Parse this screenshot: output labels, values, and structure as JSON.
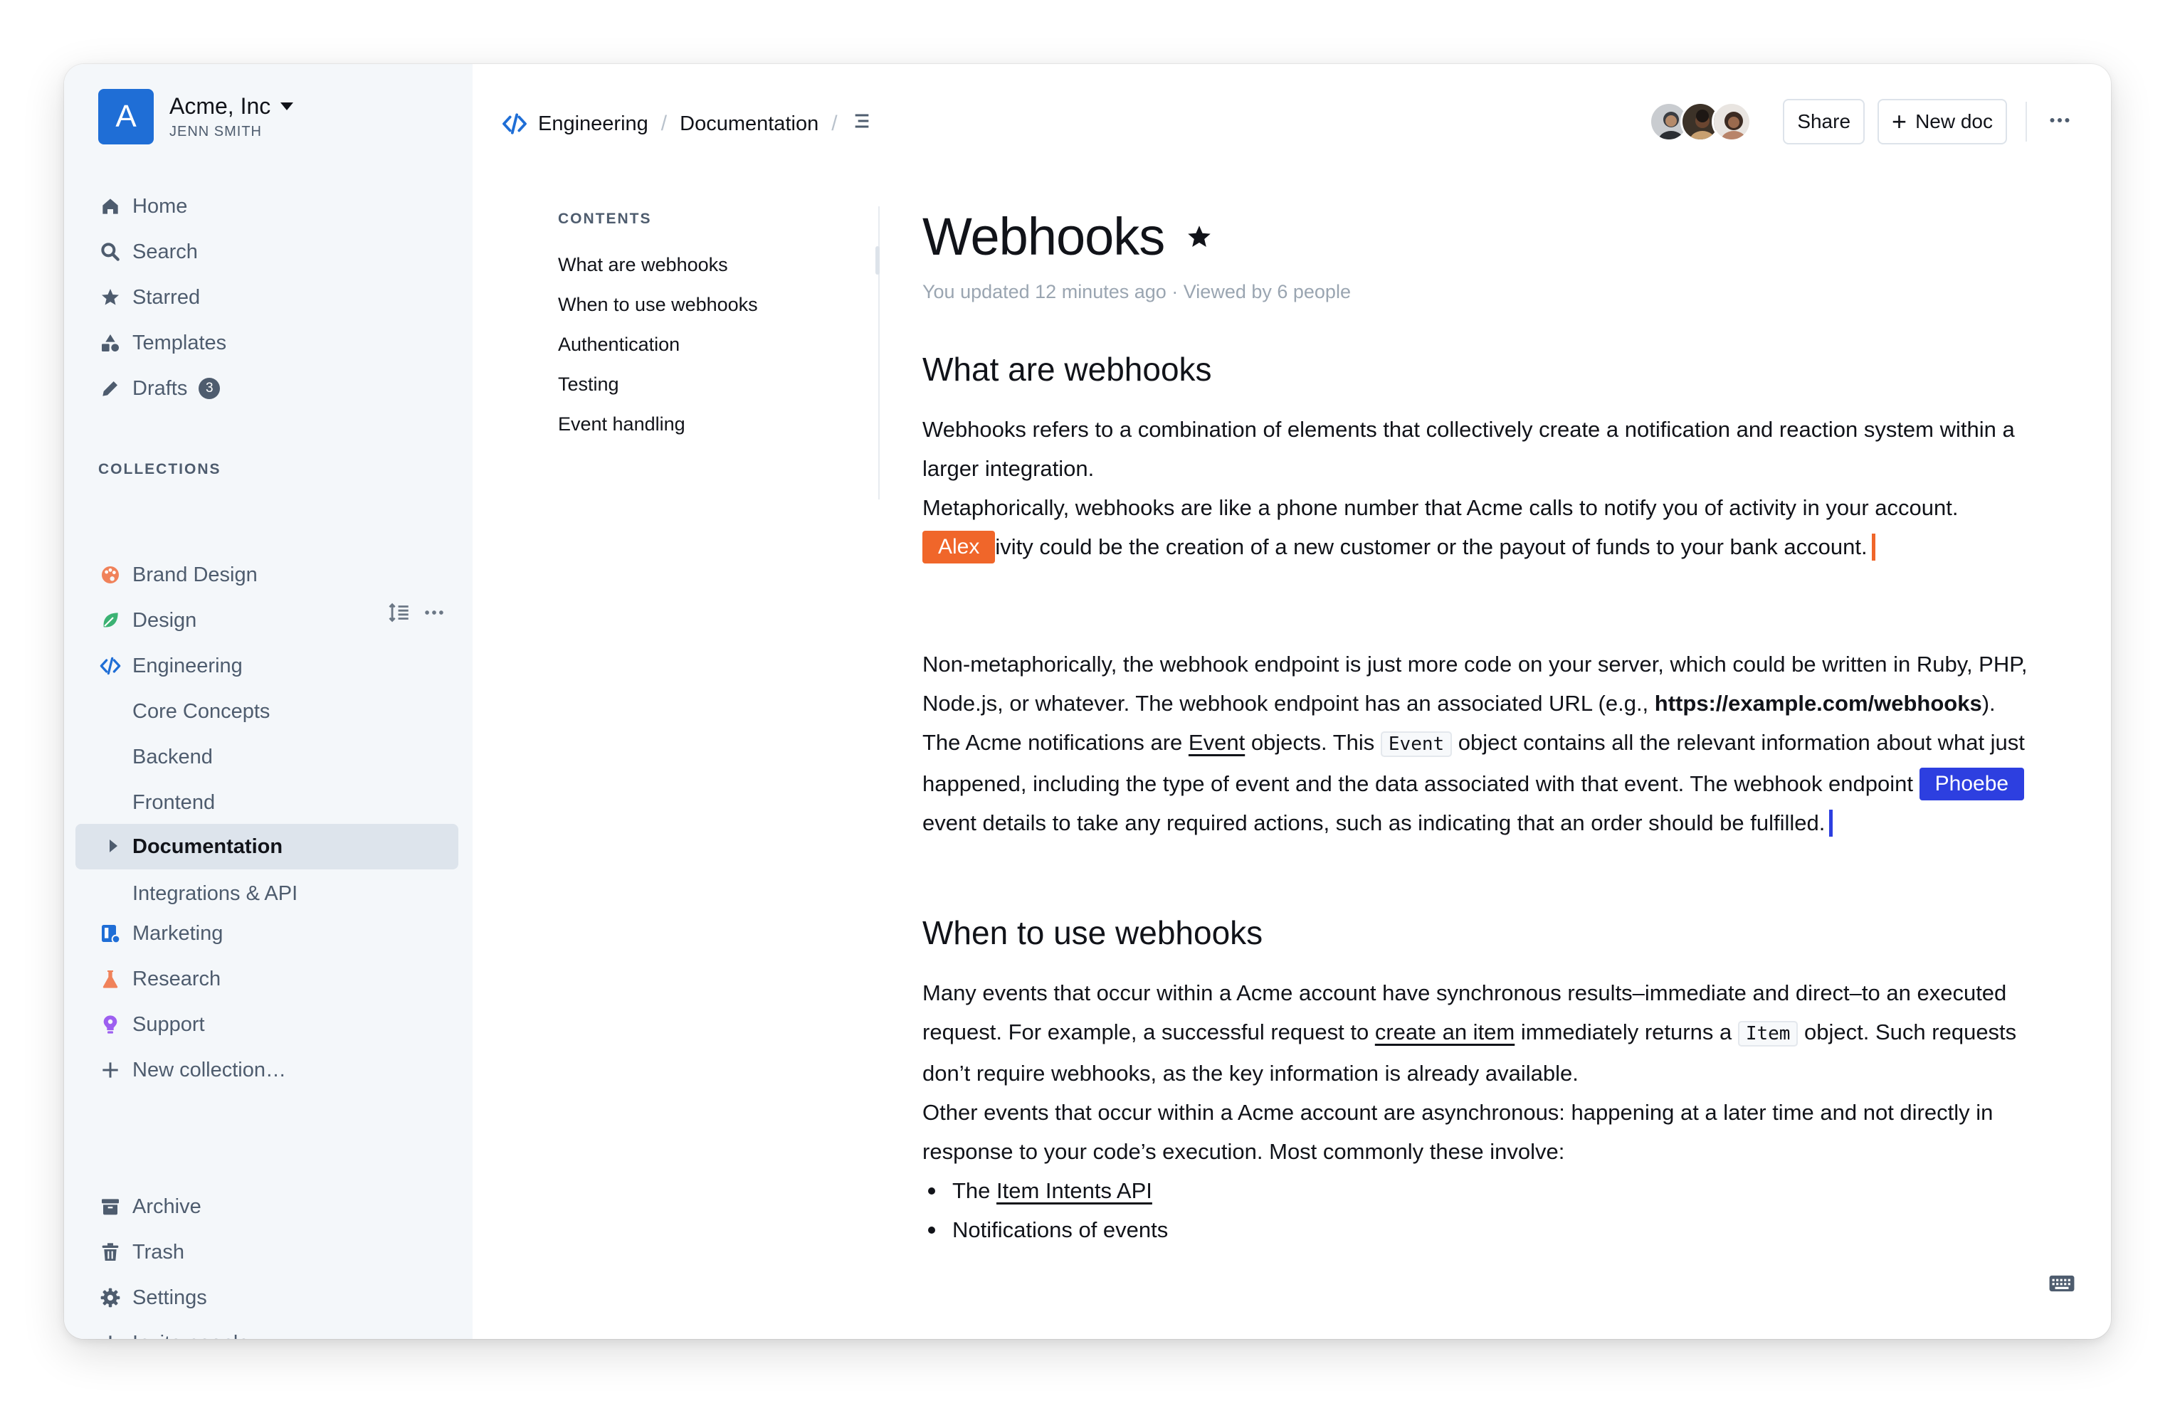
{
  "team": {
    "logo_letter": "A",
    "name": "Acme, Inc",
    "user": "JENN SMITH"
  },
  "nav": {
    "home": "Home",
    "search": "Search",
    "starred": "Starred",
    "templates": "Templates",
    "drafts": "Drafts",
    "drafts_count": "3"
  },
  "collections": {
    "label": "COLLECTIONS",
    "brand_design": "Brand Design",
    "design": "Design",
    "engineering": "Engineering",
    "engineering_children": [
      "Core Concepts",
      "Backend",
      "Frontend",
      "Documentation",
      "Integrations & API"
    ],
    "marketing": "Marketing",
    "research": "Research",
    "support": "Support",
    "new_collection": "New collection…"
  },
  "footer_nav": {
    "archive": "Archive",
    "trash": "Trash",
    "settings": "Settings",
    "invite": "Invite people…"
  },
  "breadcrumb": {
    "collection": "Engineering",
    "document": "Documentation"
  },
  "header": {
    "share": "Share",
    "new_doc": "New doc"
  },
  "toc": {
    "label": "CONTENTS",
    "items": [
      "What are webhooks",
      "When to use webhooks",
      "Authentication",
      "Testing",
      "Event handling"
    ]
  },
  "doc": {
    "title": "Webhooks",
    "meta": "You updated 12 minutes ago · Viewed by 6 people",
    "s1_heading": "What are webhooks",
    "s1_p1": "Webhooks refers to a combination of elements that collectively create a notification and reaction system within a larger integration.",
    "s1_p2_a": "Metaphorically, webhooks are like a phone number that Acme calls to notify you of activity in your account.",
    "s1_p2_b": "ivity could be the creation of a new customer or the payout of funds to your bank account.",
    "s1_p3_a": "Non-metaphorically, the webhook endpoint is just more code on your server, which could be written in Ruby, PHP, Node.js, or whatever. The webhook endpoint has an associated URL (e.g., ",
    "s1_p3_url": "https://example.com/webhooks",
    "s1_p3_b": "). The Acme notifications are ",
    "s1_p3_link": "Event",
    "s1_p3_c": " objects. This ",
    "s1_p3_code": "Event",
    "s1_p3_d": " object contains all the relevant information about what just happened, including the type of event and the data associated with that event. The webhook endpoint",
    "s1_p3_e": "event details to take any required actions, such as indicating that an order should be fulfilled.",
    "s2_heading": "When to use webhooks",
    "s2_p1_a": "Many events that occur within a Acme account have synchronous results–immediate and direct–to an executed request. For example, a successful request to ",
    "s2_p1_link": "create an item",
    "s2_p1_b": " immediately returns a ",
    "s2_p1_code": "Item",
    "s2_p1_c": " object. Such requests don’t require webhooks, as the key information is already available.",
    "s2_p2": "Other events that occur within a Acme account are asynchronous: happening at a later time and not directly in response to your code’s execution. Most commonly these involve:",
    "bullet1_prefix": "The ",
    "bullet1_link": "Item Intents API",
    "bullet2": "Notifications of events"
  },
  "collaborators": [
    {
      "name": "Alex",
      "color": "#f0662a"
    },
    {
      "name": "Phoebe",
      "color": "#2d3fe0"
    }
  ],
  "colors": {
    "accent": "#1f6ed6",
    "sidebar_bg": "#f4f7fa",
    "active_bg": "#dde4ec",
    "text": "#111319",
    "muted": "#4e5c6e"
  },
  "icons": [
    "home-icon",
    "search-icon",
    "star-icon",
    "templates-icon",
    "pencil-icon",
    "palette-icon",
    "leaf-icon",
    "code-icon",
    "marketing-icon",
    "flask-icon",
    "lightbulb-icon",
    "plus-icon",
    "archive-icon",
    "trash-icon",
    "gear-icon",
    "menu-icon",
    "more-icon",
    "keyboard-icon"
  ]
}
